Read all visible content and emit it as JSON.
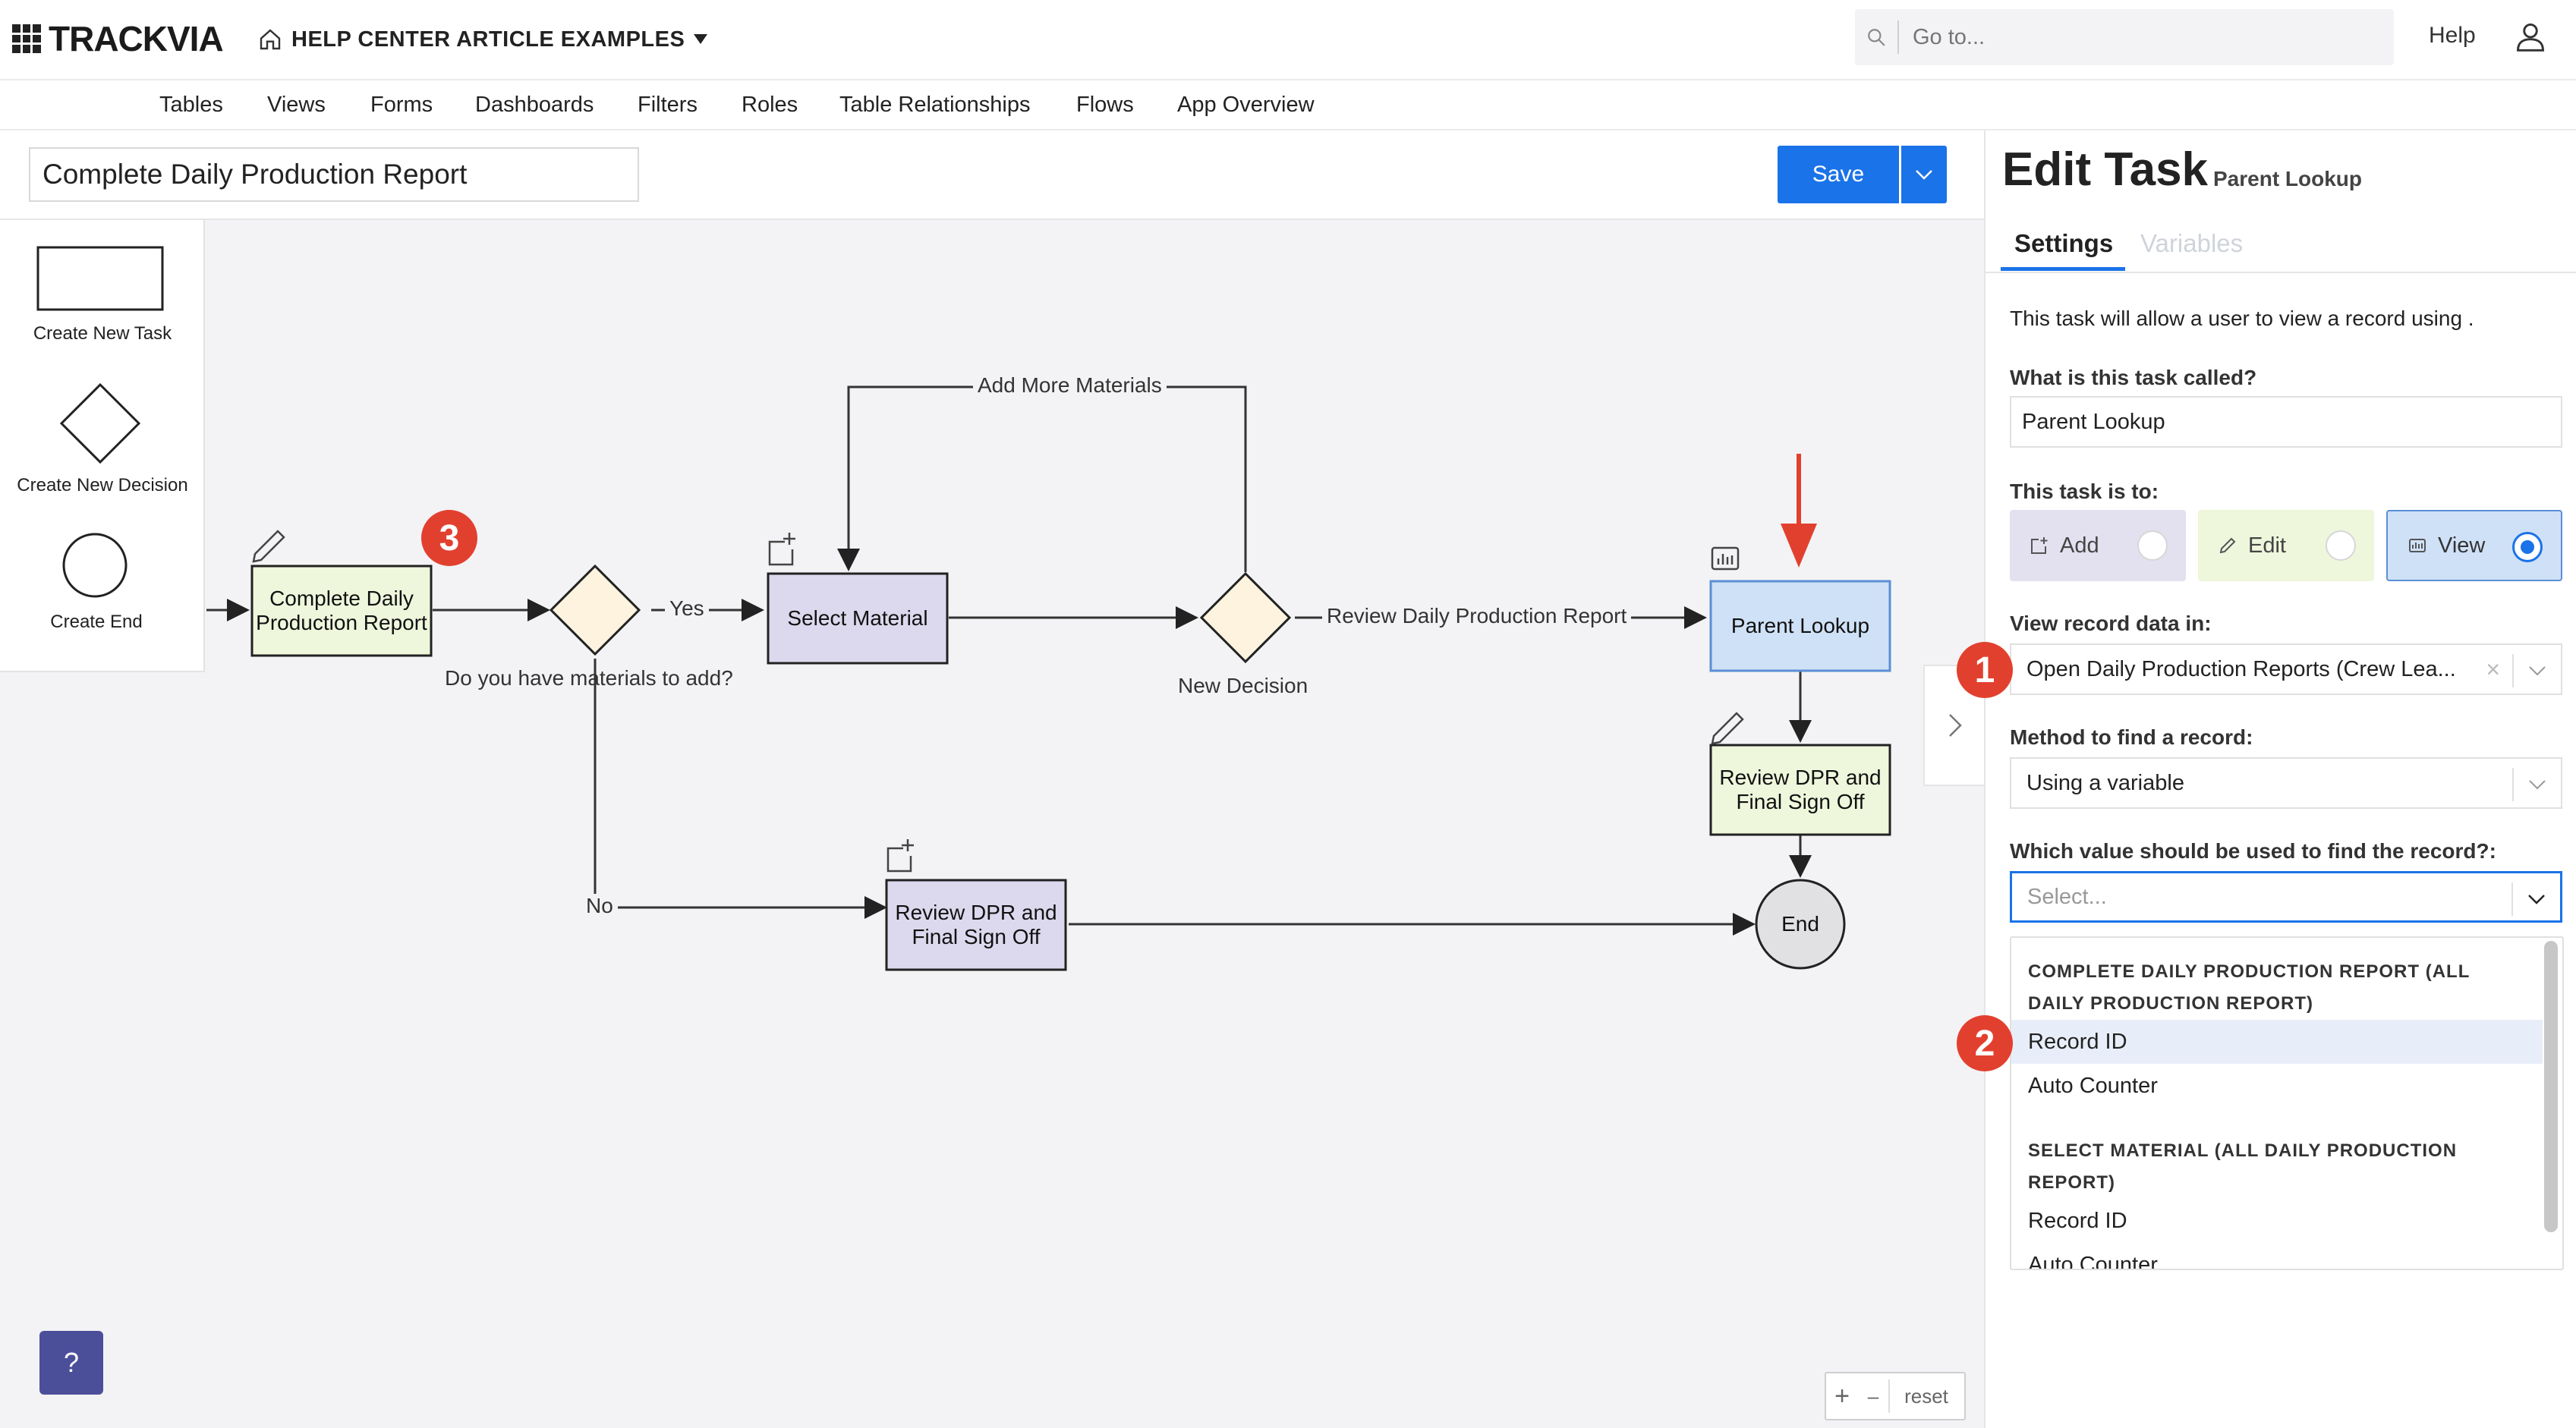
{
  "header": {
    "logo": "TRACKVIA",
    "app_name": "HELP CENTER ARTICLE EXAMPLES",
    "search_placeholder": "Go to...",
    "help": "Help"
  },
  "nav": [
    "Tables",
    "Views",
    "Forms",
    "Dashboards",
    "Filters",
    "Roles",
    "Table Relationships",
    "Flows",
    "App Overview"
  ],
  "flow": {
    "title": "Complete Daily Production Report",
    "save": "Save"
  },
  "palette": {
    "task": "Create New Task",
    "decision": "Create New Decision",
    "end": "Create End"
  },
  "diagram": {
    "node_complete": "Complete Daily Production Report",
    "node_select_material": "Select Material",
    "node_parent_lookup": "Parent Lookup",
    "node_review_right": "Review DPR and Final Sign Off",
    "node_review_bottom": "Review DPR and Final Sign Off",
    "node_end": "End",
    "decision_1_label": "Do you have materials to add?",
    "decision_2_label": "New Decision",
    "edge_yes": "Yes",
    "edge_no": "No",
    "edge_add_more": "Add More Materials",
    "edge_review": "Review Daily Production Report",
    "badge_3": "3"
  },
  "canvas_controls": {
    "help": "?",
    "zoom_in": "+",
    "zoom_out": "–",
    "reset": "reset"
  },
  "panel": {
    "title": "Edit Task",
    "subtitle": "Parent Lookup",
    "tab_settings": "Settings",
    "tab_variables": "Variables",
    "description": "This task will allow a user to view a record using .",
    "name_label": "What is this task called?",
    "name_value": "Parent Lookup",
    "task_is_label": "This task is to:",
    "opt_add": "Add",
    "opt_edit": "Edit",
    "opt_view": "View",
    "view_in_label": "View record data in:",
    "view_in_value": "Open Daily Production Reports (Crew Lea...",
    "method_label": "Method to find a record:",
    "method_value": "Using a variable",
    "which_label": "Which value should be used to find the record?:",
    "which_placeholder": "Select...",
    "badge_1": "1",
    "badge_2": "2",
    "dropdown": {
      "group1_line1": "COMPLETE DAILY PRODUCTION REPORT (ALL",
      "group1_line2": "DAILY PRODUCTION REPORT)",
      "group1_items": [
        "Record ID",
        "Auto Counter"
      ],
      "group2_line1": "SELECT MATERIAL (ALL DAILY PRODUCTION",
      "group2_line2": "REPORT)",
      "group2_items": [
        "Record ID",
        "Auto Counter"
      ]
    }
  },
  "colors": {
    "accent": "#1a73e8",
    "badge": "#e2402f",
    "task_green": "#eef6dc",
    "task_purple": "#dcd9ee",
    "task_blue": "#cfe1f7",
    "decision_fill": "#fdf3de",
    "arrow_red": "#e2402f"
  }
}
